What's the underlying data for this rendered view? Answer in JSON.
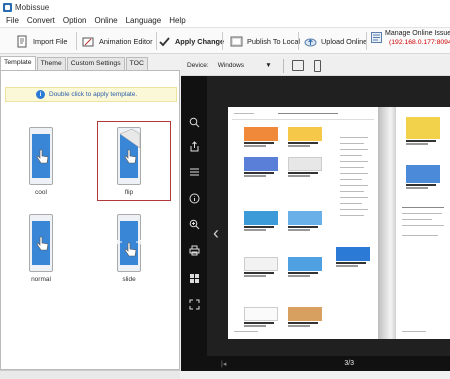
{
  "window": {
    "title": "Mobissue"
  },
  "menu": [
    "File",
    "Convert",
    "Option",
    "Online",
    "Language",
    "Help"
  ],
  "toolbar": {
    "import_label": "Import File",
    "animation_label": "Animation Editor",
    "apply_label": "Apply Change",
    "publish_label": "Publish To Local",
    "upload_label": "Upload Online",
    "manage_label": "Manage Online Issues",
    "server_text": "(192.168.0.177:8094)"
  },
  "left_tabs": [
    "Template",
    "Theme",
    "Custom Settings",
    "TOC"
  ],
  "hint": {
    "text": "Double click to apply template."
  },
  "templates": [
    {
      "label": "cool"
    },
    {
      "label": "flip",
      "selected": true
    },
    {
      "label": "normal"
    },
    {
      "label": "slide"
    }
  ],
  "device_bar": {
    "label": "Device:",
    "selected": "Windows"
  },
  "viewer": {
    "page_indicator": "3/3"
  },
  "colors": {
    "accent": "#3a86d6",
    "selected_border": "#b03a3a",
    "server_text": "#d00000"
  }
}
